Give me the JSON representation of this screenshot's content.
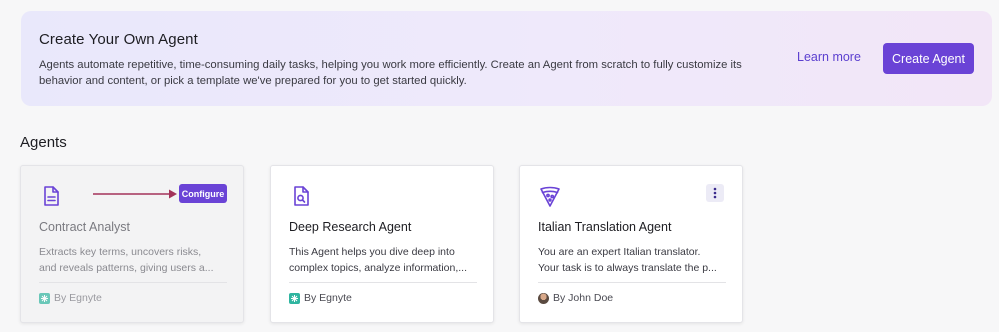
{
  "banner": {
    "title": "Create Your Own Agent",
    "description": "Agents automate repetitive, time-consuming daily tasks, helping you work more efficiently. Create an Agent from scratch to fully customize its behavior and content, or pick a template we've prepared for you to get started quickly.",
    "learn_more": "Learn more",
    "create_button": "Create Agent"
  },
  "section": {
    "title": "Agents"
  },
  "cards": [
    {
      "icon": "document-icon",
      "title": "Contract Analyst",
      "desc_line1": "Extracts key terms, uncovers risks,",
      "desc_line2": "and reveals patterns, giving users a...",
      "author": "By Egnyte",
      "author_icon": "egnyte-logo-icon",
      "action": "Configure"
    },
    {
      "icon": "search-document-icon",
      "title": "Deep Research Agent",
      "desc_line1": "This Agent helps you dive deep into",
      "desc_line2": "complex topics, analyze information,...",
      "author": "By Egnyte",
      "author_icon": "egnyte-logo-icon"
    },
    {
      "icon": "pizza-icon",
      "title": "Italian Translation Agent",
      "desc_line1": "You are an expert Italian translator.",
      "desc_line2": "Your task is to always translate the p...",
      "author": "By John Doe",
      "author_icon": "user-avatar",
      "action_icon": "kebab-menu-icon"
    }
  ],
  "colors": {
    "accent": "#6a43d6",
    "link": "#5b3fcf",
    "arrow": "#a3335a",
    "egnyte": "#2fb5a0"
  }
}
